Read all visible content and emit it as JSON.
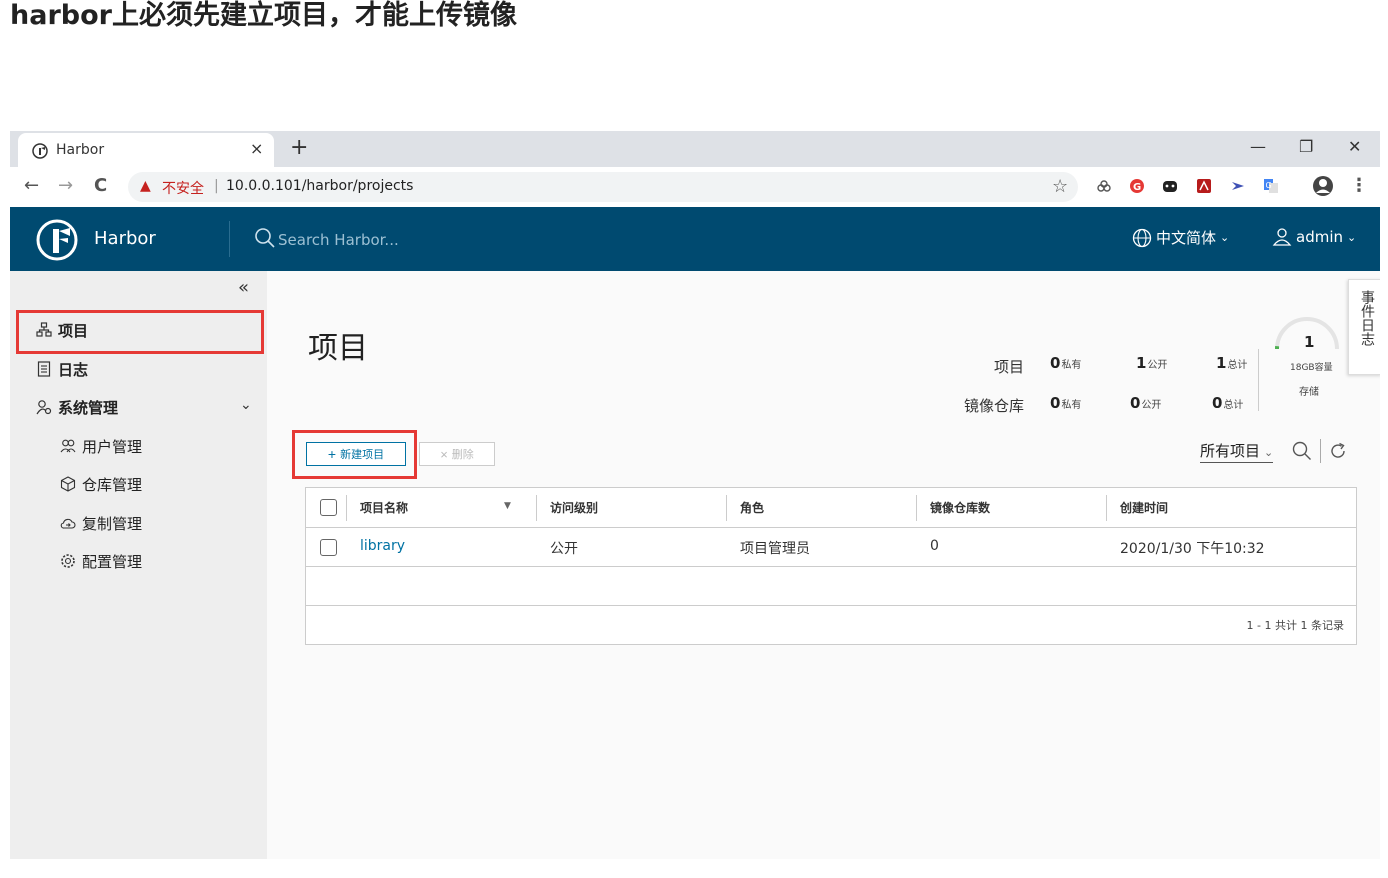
{
  "doc_heading": "harbor上必须先建立项目，才能上传镜像",
  "browser": {
    "tab_title": "Harbor",
    "tab_close": "×",
    "new_tab": "+",
    "win_min": "—",
    "win_restore": "❐",
    "win_close": "✕",
    "back": "←",
    "forward": "→",
    "reload": "C",
    "warning_icon": "▲",
    "insecure_label": "不安全",
    "separator": "|",
    "url": "10.0.0.101/harbor/projects",
    "bookmark_icon": "☆",
    "menu_icon": "⋮"
  },
  "header": {
    "brand": "Harbor",
    "search_placeholder": "Search Harbor...",
    "language": "中文简体",
    "user": "admin",
    "caret": "⌄"
  },
  "sidebar": {
    "collapse_icon": "«",
    "items": [
      {
        "label": "项目"
      },
      {
        "label": "日志"
      },
      {
        "label": "系统管理"
      }
    ],
    "sub_items": [
      {
        "label": "用户管理"
      },
      {
        "label": "仓库管理"
      },
      {
        "label": "复制管理"
      },
      {
        "label": "配置管理"
      }
    ],
    "expand_chevron": "⌄"
  },
  "main": {
    "title": "项目",
    "stats": {
      "projects_label": "项目",
      "repos_label": "镜像仓库",
      "projects_private": "0",
      "projects_public": "1",
      "projects_total": "1",
      "repos_private": "0",
      "repos_public": "0",
      "repos_total": "0",
      "private_suffix": "私有",
      "public_suffix": "公开",
      "total_suffix": "总计"
    },
    "storage": {
      "count": "1",
      "capacity": "18GB容量",
      "label": "存储",
      "used_fraction": 0.03
    },
    "event_log": "事件日志",
    "new_button": "新建项目",
    "new_icon": "+",
    "delete_button": "删除",
    "delete_icon": "×",
    "filter": "所有项目",
    "filter_caret": "⌄",
    "table": {
      "headers": [
        "项目名称",
        "访问级别",
        "角色",
        "镜像仓库数",
        "创建时间"
      ],
      "filter_icon": "▼",
      "rows": [
        {
          "name": "library",
          "access": "公开",
          "role": "项目管理员",
          "repos": "0",
          "created": "2020/1/30 下午10:32"
        }
      ],
      "footer": "1 - 1 共计 1 条记录"
    }
  },
  "colors": {
    "header_bg": "#004a70",
    "link": "#0072a3",
    "highlight": "#e53935",
    "gauge": "#4caf50"
  }
}
